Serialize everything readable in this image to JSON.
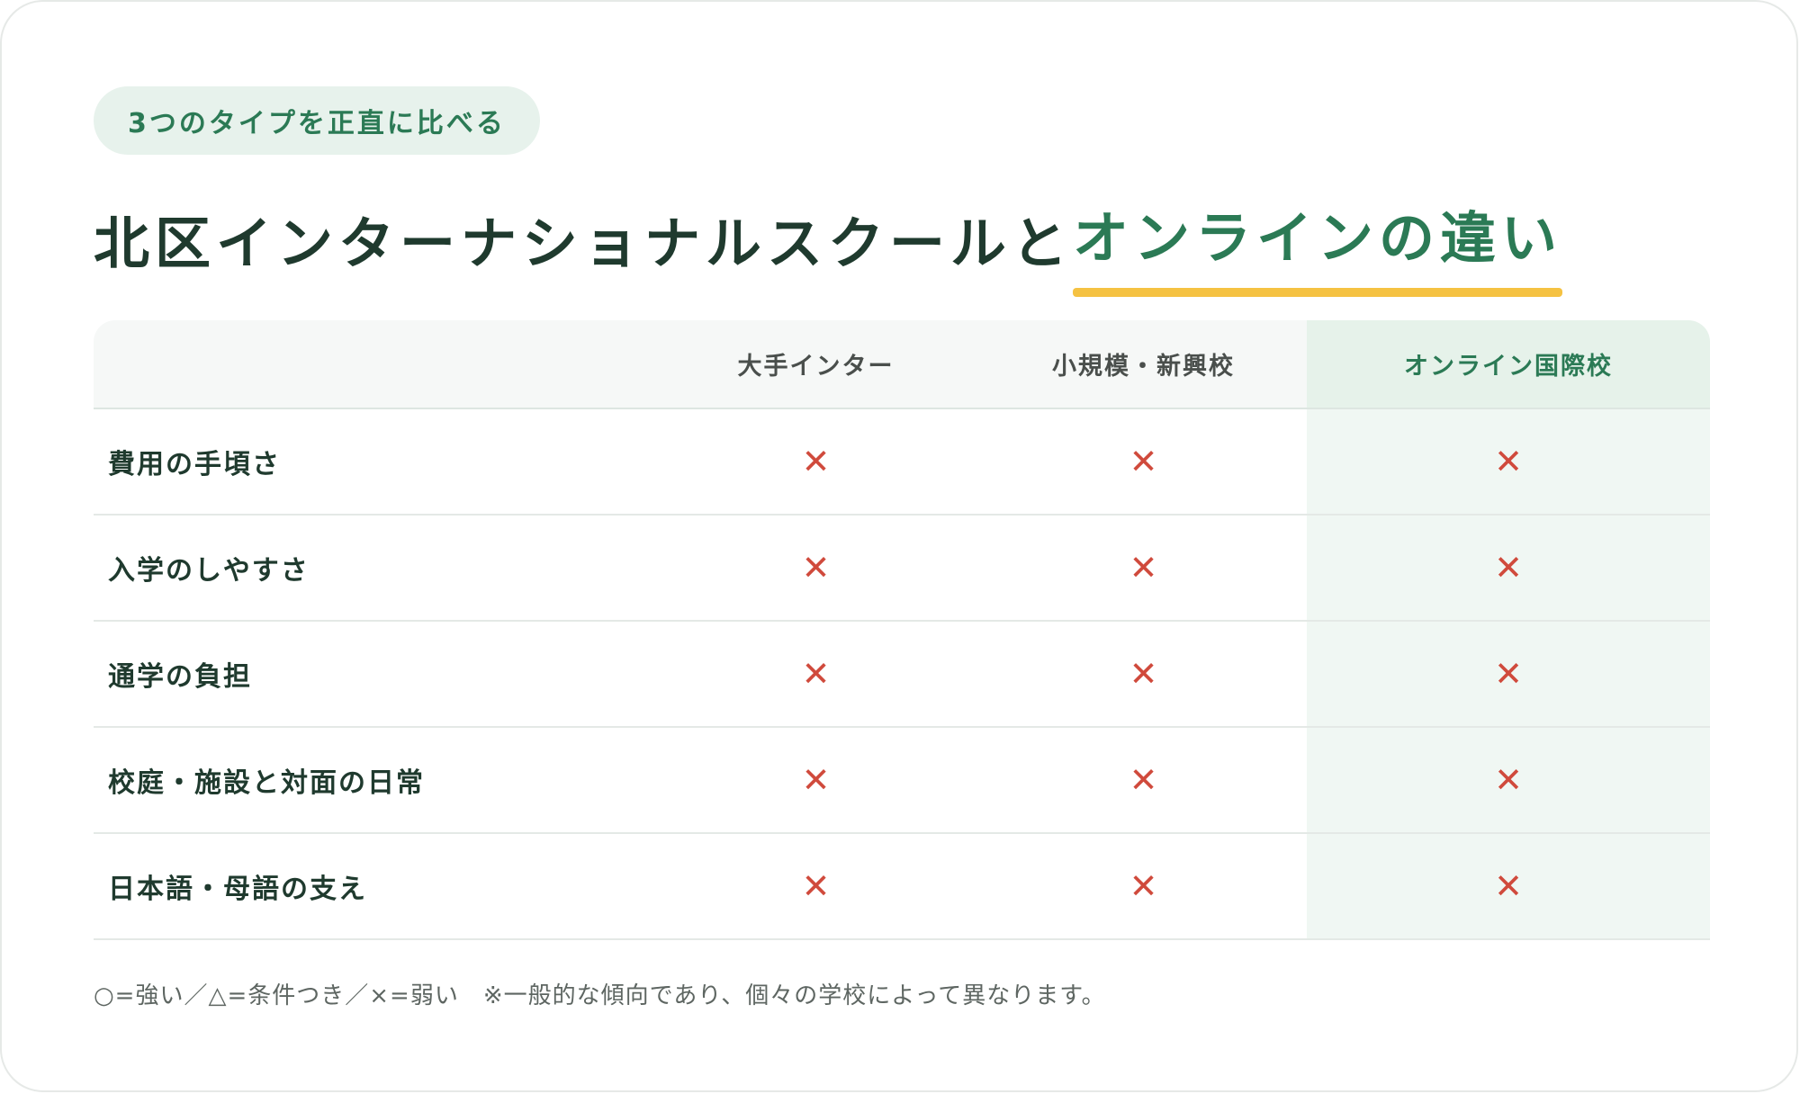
{
  "badge": "3つのタイプを正直に比べる",
  "title": {
    "main": "北区インターナショナルスクールと",
    "accent": "オンラインの違い"
  },
  "table": {
    "columns": [
      "",
      "大手インター",
      "小規模・新興校",
      "オンライン国際校"
    ],
    "rows": [
      {
        "label": "費用の手頃さ",
        "values": [
          "✕",
          "✕",
          "✕"
        ]
      },
      {
        "label": "入学のしやすさ",
        "values": [
          "✕",
          "✕",
          "✕"
        ]
      },
      {
        "label": "通学の負担",
        "values": [
          "✕",
          "✕",
          "✕"
        ]
      },
      {
        "label": "校庭・施設と対面の日常",
        "values": [
          "✕",
          "✕",
          "✕"
        ]
      },
      {
        "label": "日本語・母語の支え",
        "values": [
          "✕",
          "✕",
          "✕"
        ]
      }
    ]
  },
  "footnote": "○=強い／△=条件つき／×=弱い　※一般的な傾向であり、個々の学校によって異なります。",
  "colors": {
    "accent": "#2b7a55",
    "underline": "#f5c242",
    "cross": "#d04a3c",
    "highlight_column": "#f0f7f3"
  }
}
